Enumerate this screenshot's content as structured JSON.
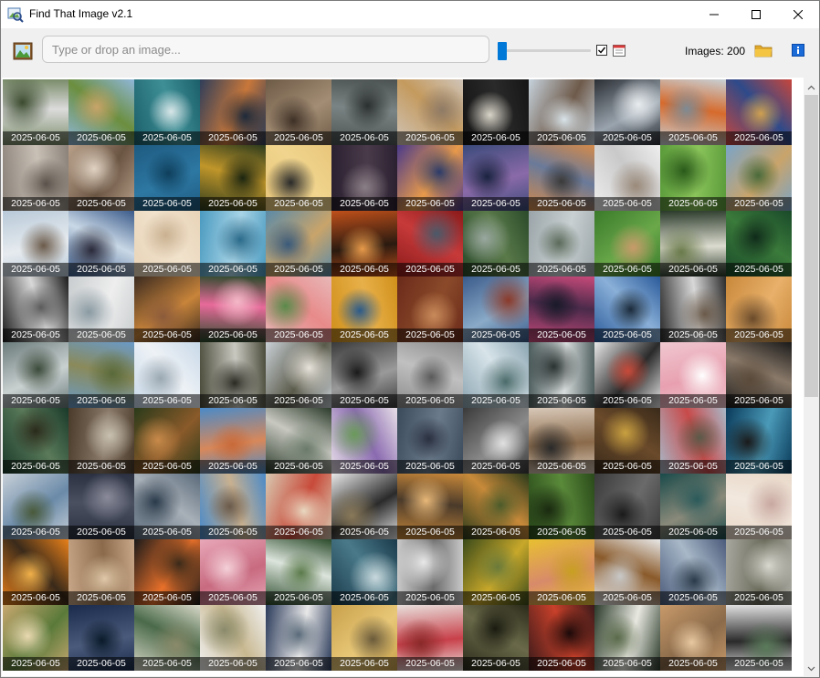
{
  "window": {
    "title": "Find That Image v2.1"
  },
  "toolbar": {
    "search_placeholder": "Type or drop an image...",
    "search_value": "",
    "slider_value_fraction": 0.0,
    "checkbox_checked": true,
    "images_label": "Images: 200"
  },
  "colors": {
    "accent": "#0078d7",
    "folder": "#f4c542",
    "caption_bg": "rgba(0,0,0,0.55)"
  },
  "icons": {
    "app": "magnifier-image-icon",
    "image_button": "image-icon",
    "calendar": "calendar-icon",
    "folder": "folder-icon",
    "info": "info-icon"
  },
  "gallery": {
    "columns": 12,
    "rows": 9,
    "caption_default": "2025-06-05",
    "tiles": [
      {
        "caption": "2025-06-05",
        "colors": [
          "#7a8c6a",
          "#dcdcdc",
          "#3b4b2e"
        ]
      },
      {
        "caption": "2025-06-05",
        "colors": [
          "#8fb7d9",
          "#6b8e3e",
          "#c8a46a"
        ]
      },
      {
        "caption": "2025-06-05",
        "colors": [
          "#1b5f6a",
          "#3e8f96",
          "#d8e6e8"
        ]
      },
      {
        "caption": "2025-06-05",
        "colors": [
          "#2f3e5a",
          "#c8773a",
          "#1e2a3a"
        ]
      },
      {
        "caption": "2025-06-05",
        "colors": [
          "#6d5a46",
          "#a38d74",
          "#3e3026"
        ]
      },
      {
        "caption": "2025-06-05",
        "colors": [
          "#4a5150",
          "#7b8484",
          "#2a2f2f"
        ]
      },
      {
        "caption": "2025-06-05",
        "colors": [
          "#cfc4b8",
          "#c49a5e",
          "#8e7a66"
        ]
      },
      {
        "caption": "2025-06-05",
        "colors": [
          "#151515",
          "#2a2a2a",
          "#d8d4c8"
        ]
      },
      {
        "caption": "2025-06-05",
        "colors": [
          "#c6d2dc",
          "#6e5a4a",
          "#d9e4ea"
        ]
      },
      {
        "caption": "2025-06-05",
        "colors": [
          "#2a2e34",
          "#9aa4ae",
          "#e8ecef"
        ]
      },
      {
        "caption": "2025-06-05",
        "colors": [
          "#c7d0d6",
          "#d66a2c",
          "#7d8b95"
        ]
      },
      {
        "caption": "2025-06-05",
        "colors": [
          "#c8463c",
          "#2e4a8a",
          "#d0a050"
        ]
      },
      {
        "caption": "2025-06-05",
        "colors": [
          "#8a8178",
          "#c9c0b6",
          "#5a524a"
        ]
      },
      {
        "caption": "2025-06-05",
        "colors": [
          "#b8a08a",
          "#6a5442",
          "#e0d2c2"
        ]
      },
      {
        "caption": "2025-06-05",
        "colors": [
          "#1e5a80",
          "#2d78a3",
          "#0f3f5c"
        ]
      },
      {
        "caption": "2025-06-05",
        "colors": [
          "#2c3a1c",
          "#c0962a",
          "#1a2410"
        ]
      },
      {
        "caption": "2025-06-05",
        "colors": [
          "#e8c67a",
          "#f1d58e",
          "#2a2a2a"
        ]
      },
      {
        "caption": "2025-06-05",
        "colors": [
          "#2a2030",
          "#4a3b4a",
          "#8a7e86"
        ]
      },
      {
        "caption": "2025-06-05",
        "colors": [
          "#4a3a8a",
          "#e89a4a",
          "#2a3a6a"
        ]
      },
      {
        "caption": "2025-06-05",
        "colors": [
          "#3a4a7a",
          "#8a6aa8",
          "#1a2340"
        ]
      },
      {
        "caption": "2025-06-05",
        "colors": [
          "#d48a4a",
          "#6a7a9a",
          "#3a3a3a"
        ]
      },
      {
        "caption": "2025-06-05",
        "colors": [
          "#eeeeee",
          "#c9c9c9",
          "#9a8a7a"
        ]
      },
      {
        "caption": "2025-06-05",
        "colors": [
          "#5a9a3a",
          "#8ac45a",
          "#2a5a1a"
        ]
      },
      {
        "caption": "2025-06-05",
        "colors": [
          "#7aa4c8",
          "#c9a46a",
          "#4a6a3a"
        ]
      },
      {
        "caption": "2025-06-05",
        "colors": [
          "#b8c9d8",
          "#e6ebef",
          "#6a5a4a"
        ]
      },
      {
        "caption": "2025-06-05",
        "colors": [
          "#3a5a8a",
          "#c9d8e6",
          "#2a2a3a"
        ]
      },
      {
        "caption": "2025-06-05",
        "colors": [
          "#e8d4b8",
          "#f1e2cc",
          "#c9b090"
        ]
      },
      {
        "caption": "2025-06-05",
        "colors": [
          "#4a9ac0",
          "#a8d4e6",
          "#2a6a8a"
        ]
      },
      {
        "caption": "2025-06-05",
        "colors": [
          "#5a8aa8",
          "#c9a46a",
          "#3a5a7a"
        ]
      },
      {
        "caption": "2025-06-05",
        "colors": [
          "#c0501a",
          "#2a1a10",
          "#e89a4a"
        ]
      },
      {
        "caption": "2025-06-05",
        "colors": [
          "#8a1a1a",
          "#c83a3a",
          "#4a5a6a"
        ]
      },
      {
        "caption": "2025-06-05",
        "colors": [
          "#2a4a2a",
          "#5a7a4a",
          "#9aa8a0"
        ]
      },
      {
        "caption": "2025-06-05",
        "colors": [
          "#9aa4a8",
          "#c9d0d2",
          "#5a6a5a"
        ]
      },
      {
        "caption": "2025-06-05",
        "colors": [
          "#3a7a2a",
          "#6aa84a",
          "#c89a6a"
        ]
      },
      {
        "caption": "2025-06-05",
        "colors": [
          "#2a3a2a",
          "#dcdcd0",
          "#6a7a4a"
        ]
      },
      {
        "caption": "2025-06-05",
        "colors": [
          "#1a4a2a",
          "#3a7a3a",
          "#0f2a1a"
        ]
      },
      {
        "caption": "2025-06-05",
        "colors": [
          "#1a1a1a",
          "#d8d8d8",
          "#5a5a5a"
        ]
      },
      {
        "caption": "2025-06-05",
        "colors": [
          "#c8ccce",
          "#eeeeee",
          "#8a9aa2"
        ]
      },
      {
        "caption": "2025-06-05",
        "colors": [
          "#3a2a20",
          "#c8843a",
          "#8a5a3a"
        ]
      },
      {
        "caption": "2025-06-05",
        "colors": [
          "#2a4a2a",
          "#e86a9a",
          "#f4b8c8"
        ]
      },
      {
        "caption": "2025-06-05",
        "colors": [
          "#e8b8b8",
          "#e88a8a",
          "#5a8a4a"
        ]
      },
      {
        "caption": "2025-06-05",
        "colors": [
          "#d0901a",
          "#e8b04a",
          "#2a5a8a"
        ]
      },
      {
        "caption": "2025-06-05",
        "colors": [
          "#6a2a1a",
          "#8a4a2a",
          "#c88a5a"
        ]
      },
      {
        "caption": "2025-06-05",
        "colors": [
          "#3a5a8a",
          "#8aaac8",
          "#8a3a2a"
        ]
      },
      {
        "caption": "2025-06-05",
        "colors": [
          "#c84a7a",
          "#4a2a4a",
          "#1a1a2a"
        ]
      },
      {
        "caption": "2025-06-05",
        "colors": [
          "#2a5a9a",
          "#8ab0d8",
          "#1a2a3a"
        ]
      },
      {
        "caption": "2025-06-05",
        "colors": [
          "#2a2a2a",
          "#d8d8d8",
          "#6a5a4a"
        ]
      },
      {
        "caption": "2025-06-05",
        "colors": [
          "#c8883a",
          "#e8b06a",
          "#6a4a2a"
        ]
      },
      {
        "caption": "2025-06-05",
        "colors": [
          "#6a7a7a",
          "#c9d0d0",
          "#3a4a3a"
        ]
      },
      {
        "caption": "2025-06-05",
        "colors": [
          "#6a9ac8",
          "#8a8a5a",
          "#5a6a3a"
        ]
      },
      {
        "caption": "2025-06-05",
        "colors": [
          "#c8d8e8",
          "#eef2f6",
          "#9aa8b2"
        ]
      },
      {
        "caption": "2025-06-05",
        "colors": [
          "#4a4a3a",
          "#c8c8c0",
          "#2a2a22"
        ]
      },
      {
        "caption": "2025-06-05",
        "colors": [
          "#c9d0d6",
          "#5a5a4a",
          "#e8e4dc"
        ]
      },
      {
        "caption": "2025-06-05",
        "colors": [
          "#3a3a3a",
          "#9a9a9a",
          "#1a1a1a"
        ]
      },
      {
        "caption": "2025-06-05",
        "colors": [
          "#8a8a8a",
          "#c0c0c0",
          "#5a5a5a"
        ]
      },
      {
        "caption": "2025-06-05",
        "colors": [
          "#8aa4b0",
          "#d8e4ea",
          "#4a6a6a"
        ]
      },
      {
        "caption": "2025-06-05",
        "colors": [
          "#4a5a5a",
          "#d8dcdc",
          "#2a3232"
        ]
      },
      {
        "caption": "2025-06-05",
        "colors": [
          "#e8e8e8",
          "#2a2a2a",
          "#c84a3a"
        ]
      },
      {
        "caption": "2025-06-05",
        "colors": [
          "#f0c8d0",
          "#e8a0b0",
          "#ffffff"
        ]
      },
      {
        "caption": "2025-06-05",
        "colors": [
          "#1a1a1a",
          "#8a7a6a",
          "#5a4a3a"
        ]
      },
      {
        "caption": "2025-06-05",
        "colors": [
          "#1a3a2a",
          "#5a7a5a",
          "#2a2a1a"
        ]
      },
      {
        "caption": "2025-06-05",
        "colors": [
          "#4a3a2a",
          "#8a7a6a",
          "#c8c0b0"
        ]
      },
      {
        "caption": "2025-06-05",
        "colors": [
          "#2a3a1a",
          "#8a5a2a",
          "#c88a4a"
        ]
      },
      {
        "caption": "2025-06-05",
        "colors": [
          "#4a8ac8",
          "#d8885a",
          "#c86a3a"
        ]
      },
      {
        "caption": "2025-06-05",
        "colors": [
          "#2a3a2a",
          "#c8c8c0",
          "#6a7a6a"
        ]
      },
      {
        "caption": "2025-06-05",
        "colors": [
          "#e8e0e8",
          "#8a6ab0",
          "#6a9a5a"
        ]
      },
      {
        "caption": "2025-06-05",
        "colors": [
          "#3a4a5a",
          "#6a7a8a",
          "#2a3040"
        ]
      },
      {
        "caption": "2025-06-05",
        "colors": [
          "#3a3a3a",
          "#8a8a8a",
          "#e0e0e0"
        ]
      },
      {
        "caption": "2025-06-05",
        "colors": [
          "#d8c8b8",
          "#8a6a4a",
          "#2a2a2a"
        ]
      },
      {
        "caption": "2025-06-05",
        "colors": [
          "#3a2a1a",
          "#6a4a2a",
          "#c8a040"
        ]
      },
      {
        "caption": "2025-06-05",
        "colors": [
          "#a8b8c8",
          "#c84a4a",
          "#5a5a4a"
        ]
      },
      {
        "caption": "2025-06-05",
        "colors": [
          "#0a3a5a",
          "#4a9ab8",
          "#1a1a1a"
        ]
      },
      {
        "caption": "2025-06-05",
        "colors": [
          "#c8d0d8",
          "#6a8aa8",
          "#4a5a3a"
        ]
      },
      {
        "caption": "2025-06-05",
        "colors": [
          "#2a3040",
          "#4a5060",
          "#8a8a9a"
        ]
      },
      {
        "caption": "2025-06-05",
        "colors": [
          "#5a6a7a",
          "#a8b0b8",
          "#2a3a4a"
        ]
      },
      {
        "caption": "2025-06-05",
        "colors": [
          "#4a8ac8",
          "#c8b090",
          "#6a5a4a"
        ]
      },
      {
        "caption": "2025-06-05",
        "colors": [
          "#d8c8b0",
          "#c84a3a",
          "#e8d8c0"
        ]
      },
      {
        "caption": "2025-06-05",
        "colors": [
          "#e8e8e8",
          "#2a2a2a",
          "#8a7a5a"
        ]
      },
      {
        "caption": "2025-06-05",
        "colors": [
          "#c8883a",
          "#4a3a2a",
          "#e8b878"
        ]
      },
      {
        "caption": "2025-06-05",
        "colors": [
          "#2a3a1a",
          "#c88a3a",
          "#4a5a2a"
        ]
      },
      {
        "caption": "2025-06-05",
        "colors": [
          "#2a4a1a",
          "#5a8a3a",
          "#1a2a10"
        ]
      },
      {
        "caption": "2025-06-05",
        "colors": [
          "#3a3a3a",
          "#6a6a6a",
          "#1a1a1a"
        ]
      },
      {
        "caption": "2025-06-05",
        "colors": [
          "#1a4a4a",
          "#8a8a7a",
          "#2a5a5a"
        ]
      },
      {
        "caption": "2025-06-05",
        "colors": [
          "#e8d8c8",
          "#f2e8de",
          "#c8a8a0"
        ]
      },
      {
        "caption": "2025-06-05",
        "colors": [
          "#e8801a",
          "#3a2a1a",
          "#f0b04a"
        ]
      },
      {
        "caption": "2025-06-05",
        "colors": [
          "#c8a888",
          "#8a6a4a",
          "#e0c8a8"
        ]
      },
      {
        "caption": "2025-06-05",
        "colors": [
          "#1a1a1a",
          "#e8702a",
          "#3a2a1a"
        ]
      },
      {
        "caption": "2025-06-05",
        "colors": [
          "#e8a8b8",
          "#c86a80",
          "#f4d0d8"
        ]
      },
      {
        "caption": "2025-06-05",
        "colors": [
          "#2a4a2a",
          "#dce4dc",
          "#5a7a4a"
        ]
      },
      {
        "caption": "2025-06-05",
        "colors": [
          "#1a3a4a",
          "#4a7a8a",
          "#c8d8dc"
        ]
      },
      {
        "caption": "2025-06-05",
        "colors": [
          "#c8c8c8",
          "#6a6a6a",
          "#e8e8e8"
        ]
      },
      {
        "caption": "2025-06-05",
        "colors": [
          "#3a4a1a",
          "#c8a82a",
          "#6a7a3a"
        ]
      },
      {
        "caption": "2025-06-05",
        "colors": [
          "#e8c030",
          "#d88a6a",
          "#c8a020"
        ]
      },
      {
        "caption": "2025-06-05",
        "colors": [
          "#e8e8e8",
          "#8a5a2a",
          "#c8c8c8"
        ]
      },
      {
        "caption": "2025-06-05",
        "colors": [
          "#4a5a7a",
          "#a8b8c8",
          "#2a3a4a"
        ]
      },
      {
        "caption": "2025-06-05",
        "colors": [
          "#a8a8a0",
          "#6a6a5a",
          "#d8d8d0"
        ]
      },
      {
        "caption": "2025-06-05",
        "colors": [
          "#c8a870",
          "#5a7a3a",
          "#e8d8b0"
        ]
      },
      {
        "caption": "2025-06-05",
        "colors": [
          "#1a2a4a",
          "#4a5a7a",
          "#0a1a2a"
        ]
      },
      {
        "caption": "2025-06-05",
        "colors": [
          "#d8d8c8",
          "#4a6a4a",
          "#8a8a6a"
        ]
      },
      {
        "caption": "2025-06-05",
        "colors": [
          "#f0f0f0",
          "#c8b890",
          "#8a8a6a"
        ]
      },
      {
        "caption": "2025-06-05",
        "colors": [
          "#2a3a5a",
          "#e8e8e8",
          "#5a6a7a"
        ]
      },
      {
        "caption": "2025-06-05",
        "colors": [
          "#c8a04a",
          "#e8c878",
          "#6a5a3a"
        ]
      },
      {
        "caption": "2025-06-05",
        "colors": [
          "#e8e0dc",
          "#c8404a",
          "#8a2a2a"
        ]
      },
      {
        "caption": "2025-06-05",
        "colors": [
          "#2a2a1a",
          "#6a6a4a",
          "#1a1a10"
        ]
      },
      {
        "caption": "2025-06-05",
        "colors": [
          "#3a1a1a",
          "#c8402a",
          "#1a0a0a"
        ]
      },
      {
        "caption": "2025-06-05",
        "colors": [
          "#2a3a2a",
          "#e8e8e0",
          "#5a6a4a"
        ]
      },
      {
        "caption": "2025-06-05",
        "colors": [
          "#c89a6a",
          "#8a6a4a",
          "#e8c8a0"
        ]
      },
      {
        "caption": "2025-06-05",
        "colors": [
          "#e0e0e0",
          "#2a2a2a",
          "#5a7a5a"
        ]
      }
    ]
  }
}
